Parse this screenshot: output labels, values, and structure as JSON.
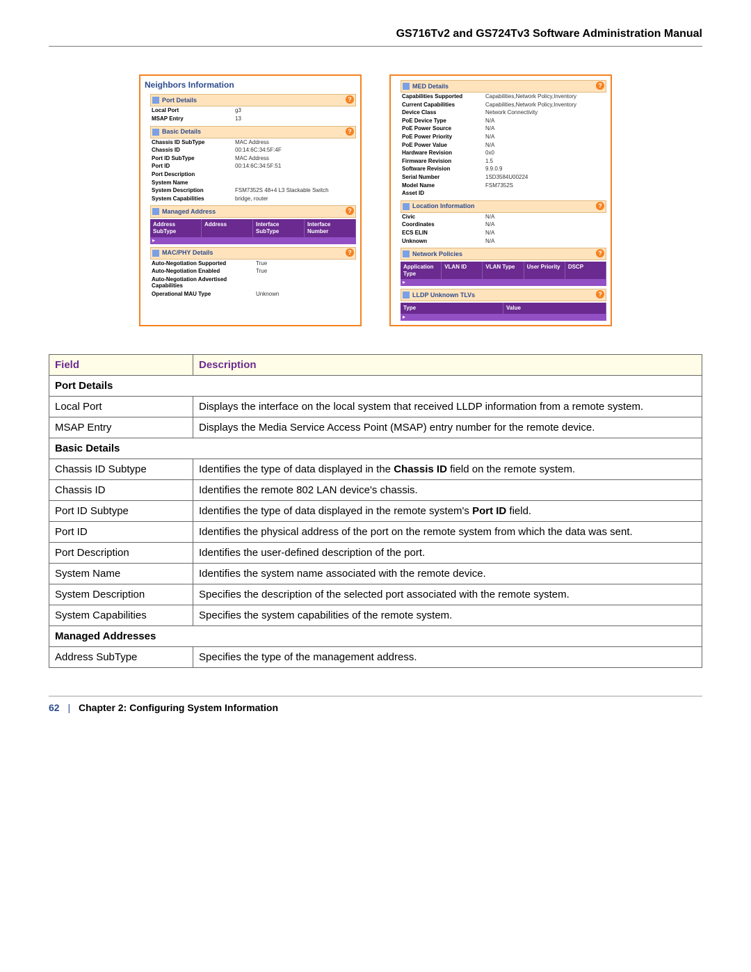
{
  "doc_title": "GS716Tv2 and GS724Tv3 Software Administration Manual",
  "footer": {
    "page": "62",
    "sep": "|",
    "chapter": "Chapter 2:  Configuring System Information"
  },
  "left_shot": {
    "title": "Neighbors Information",
    "port_details": {
      "header": "Port Details",
      "rows": [
        {
          "k": "Local Port",
          "v": "g3"
        },
        {
          "k": "MSAP Entry",
          "v": "13"
        }
      ]
    },
    "basic_details": {
      "header": "Basic Details",
      "rows": [
        {
          "k": "Chassis ID SubType",
          "v": "MAC Address"
        },
        {
          "k": "Chassis ID",
          "v": "00:14:6C:34:5F:4F"
        },
        {
          "k": "Port ID SubType",
          "v": "MAC Address"
        },
        {
          "k": "Port ID",
          "v": "00:14:6C:34:5F:51"
        },
        {
          "k": "Port Description",
          "v": ""
        },
        {
          "k": "System Name",
          "v": ""
        },
        {
          "k": "System Description",
          "v": "FSM7352S 48+4 L3 Stackable Switch"
        },
        {
          "k": "System Capabilities",
          "v": "bridge, router"
        }
      ]
    },
    "managed_address": {
      "header": "Managed Address",
      "cols": [
        "Address SubType",
        "Address",
        "Interface SubType",
        "Interface Number"
      ]
    },
    "macphy": {
      "header": "MAC/PHY Details",
      "rows": [
        {
          "k": "Auto-Negotiation Supported",
          "v": "True"
        },
        {
          "k": "Auto-Negotiation Enabled",
          "v": "True"
        },
        {
          "k": "Auto-Negotiation Advertised Capabilities",
          "v": ""
        },
        {
          "k": "Operational MAU Type",
          "v": "Unknown"
        }
      ]
    }
  },
  "right_shot": {
    "med": {
      "header": "MED Details",
      "rows": [
        {
          "k": "Capabilities Supported",
          "v": "Capabilities,Network Policy,Inventory"
        },
        {
          "k": "Current Capabilities",
          "v": "Capabilities,Network Policy,Inventory"
        },
        {
          "k": "Device Class",
          "v": "Network Connectivity"
        },
        {
          "k": "PoE Device Type",
          "v": "N/A"
        },
        {
          "k": "PoE Power Source",
          "v": "N/A"
        },
        {
          "k": "PoE Power Priority",
          "v": "N/A"
        },
        {
          "k": "PoE Power Value",
          "v": "N/A"
        },
        {
          "k": "Hardware Revision",
          "v": "0x0"
        },
        {
          "k": "Firmware Revision",
          "v": "1.5"
        },
        {
          "k": "Software Revision",
          "v": "9.9.0.9"
        },
        {
          "k": "Serial Number",
          "v": "1SD3584U00224"
        },
        {
          "k": "Model Name",
          "v": "FSM7352S"
        },
        {
          "k": "Asset ID",
          "v": ""
        }
      ]
    },
    "location": {
      "header": "Location Information",
      "rows": [
        {
          "k": "Civic",
          "v": "N/A"
        },
        {
          "k": "Coordinates",
          "v": "N/A"
        },
        {
          "k": "ECS ELIN",
          "v": "N/A"
        },
        {
          "k": "Unknown",
          "v": "N/A"
        }
      ]
    },
    "network_policies": {
      "header": "Network Policies",
      "cols": [
        "Application Type",
        "VLAN ID",
        "VLAN Type",
        "User Priority",
        "DSCP"
      ]
    },
    "unknown_tlvs": {
      "header": "LLDP Unknown TLVs",
      "cols": [
        "Type",
        "Value"
      ]
    }
  },
  "table": {
    "headers": {
      "field": "Field",
      "desc": "Description"
    },
    "rows": [
      {
        "type": "section",
        "field": "Port Details"
      },
      {
        "type": "row",
        "field": "Local Port",
        "desc": "Displays the interface on the local system that received LLDP information from a remote system."
      },
      {
        "type": "row",
        "field": "MSAP Entry",
        "desc": "Displays the Media Service Access Point (MSAP) entry number for the remote device."
      },
      {
        "type": "section",
        "field": "Basic Details"
      },
      {
        "type": "row",
        "field": "Chassis ID Subtype",
        "desc_html": "Identifies the type of data displayed in the <b>Chassis ID</b> field on the remote system."
      },
      {
        "type": "row",
        "field": "Chassis ID",
        "desc": "Identifies the remote 802 LAN device's chassis."
      },
      {
        "type": "row",
        "field": "Port ID Subtype",
        "desc_html": "Identifies the type of data displayed in the remote system's <b>Port ID</b> field."
      },
      {
        "type": "row",
        "field": "Port ID",
        "desc": "Identifies the physical address of the port on the remote system from which the data was sent."
      },
      {
        "type": "row",
        "field": "Port Description",
        "desc": "Identifies the user-defined description of the port."
      },
      {
        "type": "row",
        "field": "System Name",
        "desc": "Identifies the system name associated with the remote device."
      },
      {
        "type": "row",
        "field": "System Description",
        "desc": "Specifies the description of the selected port associated with the remote system."
      },
      {
        "type": "row",
        "field": "System Capabilities",
        "desc": "Specifies the system capabilities of the remote system."
      },
      {
        "type": "section",
        "field": "Managed Addresses"
      },
      {
        "type": "row",
        "field": "Address SubType",
        "desc": "Specifies the type of the management address."
      }
    ]
  }
}
